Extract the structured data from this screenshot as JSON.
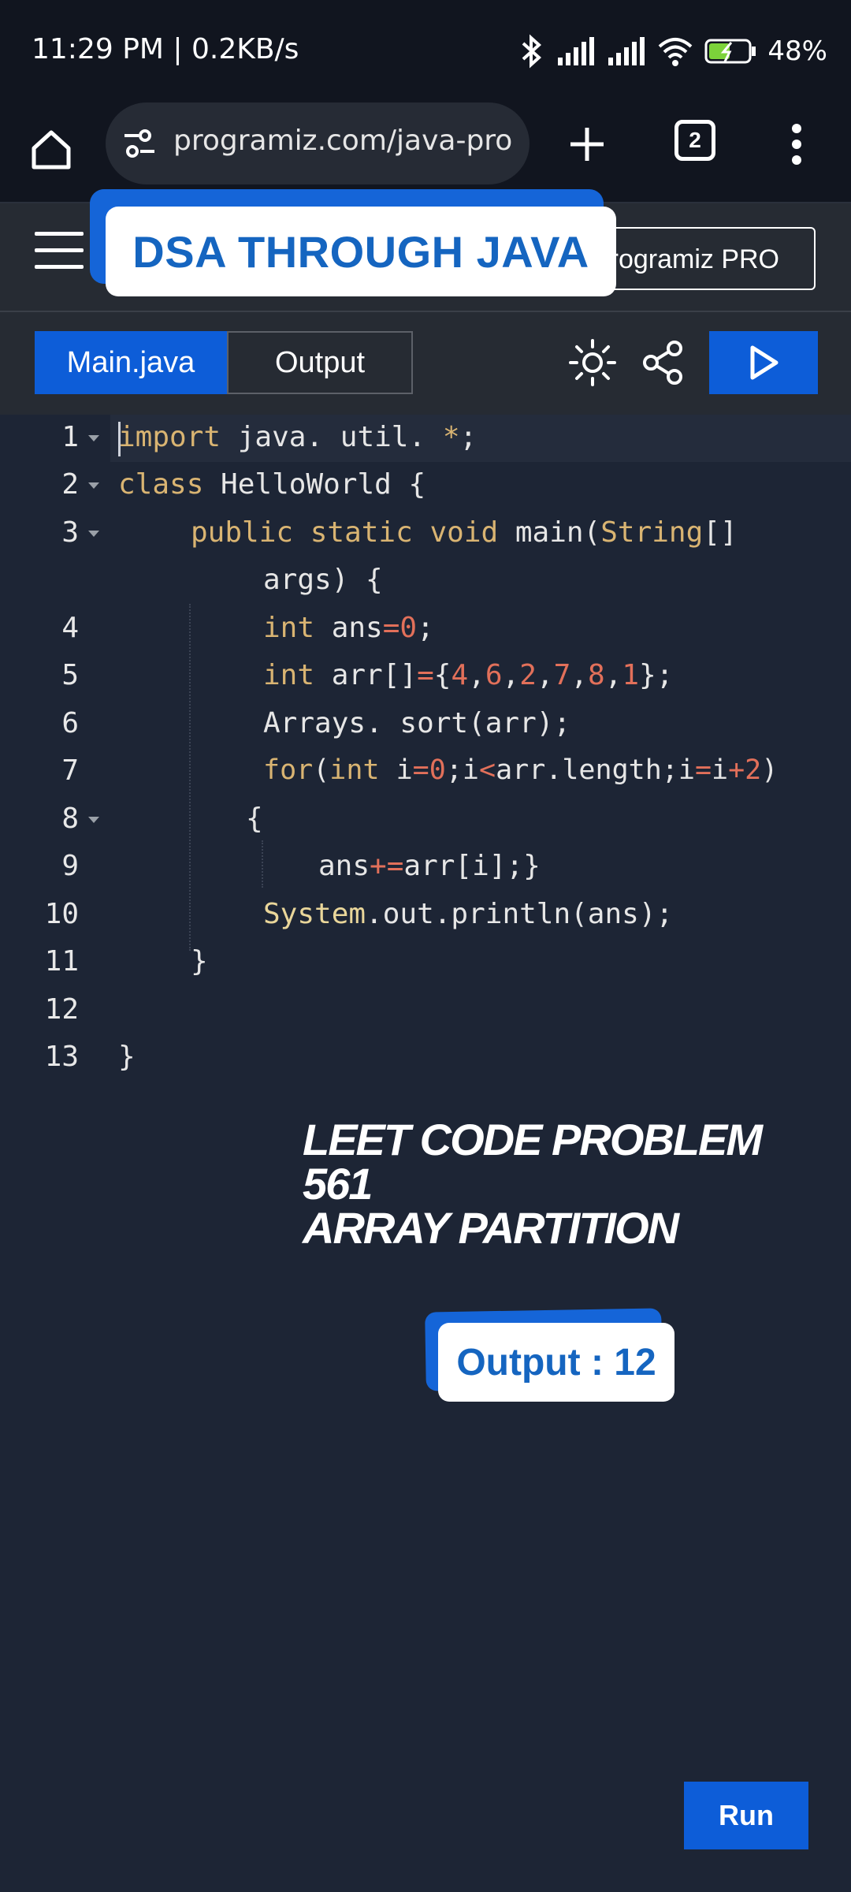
{
  "status_bar": {
    "time": "11:29 PM | 0.2KB/s",
    "battery": "48%"
  },
  "browser": {
    "url": "programiz.com/java-progra",
    "tab_count": "2"
  },
  "site_header": {
    "pro_label": "rogramiz PRO"
  },
  "overlay": {
    "title": "DSA THROUGH JAVA",
    "caption_line1": "LEET CODE PROBLEM 561",
    "caption_line2": "ARRAY PARTITION",
    "output_label": "Output : 12"
  },
  "editor_tabs": {
    "main": "Main.java",
    "output": "Output"
  },
  "line_numbers": [
    "1",
    "2",
    "3",
    "4",
    "5",
    "6",
    "7",
    "8",
    "9",
    "10",
    "11",
    "12",
    "13"
  ],
  "code": {
    "l1_kw": "import",
    "l1_rest": " java. util. ",
    "l1_star": "*",
    "l1_end": ";",
    "l2_kw": "class",
    "l2_rest": " HelloWorld {",
    "l3_kw1": "public",
    "l3_kw2": "static",
    "l3_kw3": "void",
    "l3_mid": " main(",
    "l3_type": "String",
    "l3_end": "[]",
    "l3b": "args) {",
    "l4_kw": "int",
    "l4_a": " ans",
    "l4_op": "=",
    "l4_num": "0",
    "l4_end": ";",
    "l5_kw": "int",
    "l5_a": " arr[]",
    "l5_op": "=",
    "l5_b": "{",
    "l5_n1": "4",
    "l5_n2": "6",
    "l5_n3": "2",
    "l5_n4": "7",
    "l5_n5": "8",
    "l5_n6": "1",
    "l5_end": "};",
    "l6": "Arrays. sort(arr);",
    "l7_kw1": "for",
    "l7_a": "(",
    "l7_kw2": "int",
    "l7_b": " i",
    "l7_op1": "=",
    "l7_n1": "0",
    "l7_c": ";i",
    "l7_op2": "<",
    "l7_d": "arr.length;i",
    "l7_op3": "=",
    "l7_e": "i",
    "l7_op4": "+",
    "l7_n2": "2",
    "l7_f": ")",
    "l8": "{",
    "l9_a": "ans",
    "l9_op": "+=",
    "l9_b": "arr[i];}",
    "l10_cls": "System",
    "l10_rest": ".out.println(ans);",
    "l11": "}",
    "l13": "}"
  },
  "run_button": "Run",
  "colors": {
    "accent": "#0d5dd8",
    "background": "#1d2535",
    "keyword": "#d9b472",
    "number": "#e2705a"
  },
  "icons": [
    "home-icon",
    "site-info-icon",
    "plus-icon",
    "tabs-icon",
    "more-vert-icon",
    "hamburger-icon",
    "sun-icon",
    "share-icon",
    "play-icon"
  ]
}
